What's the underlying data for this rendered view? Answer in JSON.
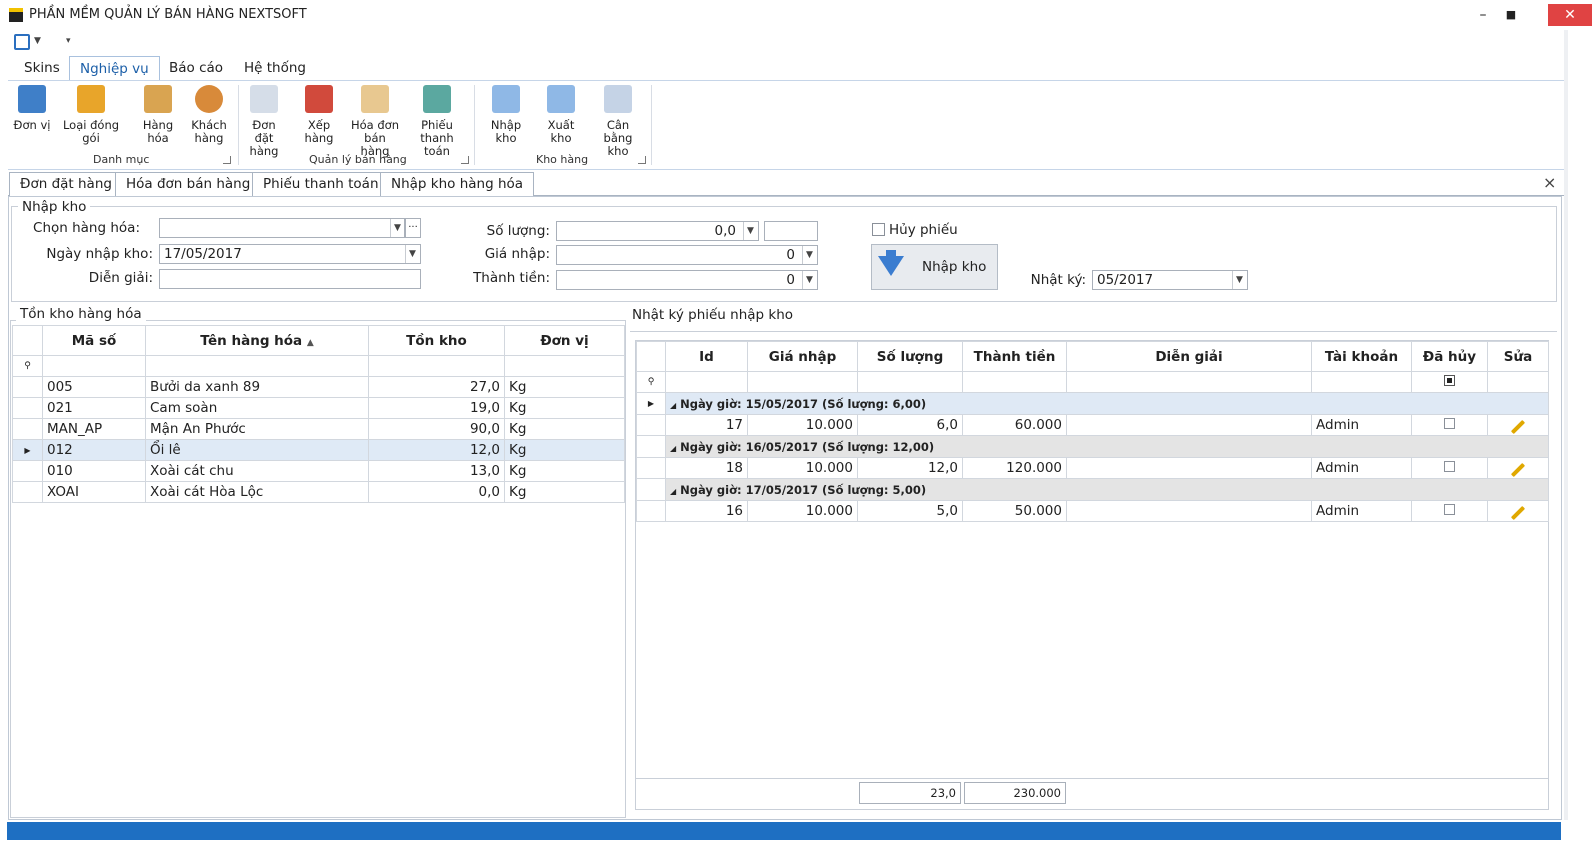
{
  "window": {
    "title": "PHẦN MỀM QUẢN LÝ BÁN HÀNG NEXTSOFT",
    "minimize": "–",
    "maximize": "■",
    "close": "✕"
  },
  "ribbon_tabs": [
    "Skins",
    "Nghiệp vụ",
    "Báo cáo",
    "Hệ thống"
  ],
  "ribbon": {
    "groups": [
      {
        "label": "Danh mục",
        "buttons": [
          "Đơn vị",
          "Loại đóng gói",
          "Hàng hóa",
          "Khách hàng"
        ]
      },
      {
        "label": "Quản lý bán hàng",
        "buttons": [
          "Đơn đặt hàng",
          "Xếp hàng",
          "Hóa đơn bán hàng",
          "Phiếu thanh toán"
        ]
      },
      {
        "label": "Kho hàng",
        "buttons": [
          "Nhập kho",
          "Xuất kho",
          "Cân bằng kho"
        ]
      }
    ]
  },
  "doc_tabs": [
    "Đơn đặt hàng",
    "Hóa đơn bán hàng",
    "Phiếu thanh toán",
    "Nhập kho hàng hóa"
  ],
  "doc_close": "×",
  "nhap_kho": {
    "title": "Nhập kho",
    "chon_hang_label": "Chọn hàng hóa:",
    "ngay_label": "Ngày nhập kho:",
    "ngay_value": "17/05/2017",
    "dien_giai_label": "Diễn giải:",
    "so_luong_label": "Số lượng:",
    "so_luong_value": "0,0",
    "gia_nhap_label": "Giá nhập:",
    "gia_nhap_value": "0",
    "thanh_tien_label": "Thành tiền:",
    "thanh_tien_value": "0",
    "huy_phieu_label": "Hủy phiếu",
    "button_label": "Nhập kho",
    "nhat_ky_label": "Nhật ký:",
    "nhat_ky_value": "05/2017"
  },
  "ton_kho": {
    "title": "Tồn kho hàng hóa",
    "columns": [
      "Mã số",
      "Tên hàng hóa",
      "Tồn kho",
      "Đơn vị"
    ],
    "rows": [
      [
        "005",
        "Bưởi da xanh 89",
        "27,0",
        "Kg"
      ],
      [
        "021",
        "Cam soàn",
        "19,0",
        "Kg"
      ],
      [
        "MAN_AP",
        "Mận An Phước",
        "90,0",
        "Kg"
      ],
      [
        "012",
        "Ổi lê",
        "12,0",
        "Kg"
      ],
      [
        "010",
        "Xoài cát chu",
        "13,0",
        "Kg"
      ],
      [
        "XOAI",
        "Xoài cát Hòa Lộc",
        "0,0",
        "Kg"
      ]
    ]
  },
  "nhat_ky": {
    "title": "Nhật ký phiếu nhập kho",
    "columns": [
      "Id",
      "Giá nhập",
      "Số lượng",
      "Thành tiền",
      "Diễn giải",
      "Tài khoản",
      "Đã hủy",
      "Sửa"
    ],
    "groups": [
      {
        "header": "Ngày giờ: 15/05/2017 (Số lượng: 6,00)",
        "row": [
          "17",
          "10.000",
          "6,0",
          "60.000",
          "",
          "Admin"
        ]
      },
      {
        "header": "Ngày giờ: 16/05/2017 (Số lượng: 12,00)",
        "row": [
          "18",
          "10.000",
          "12,0",
          "120.000",
          "",
          "Admin"
        ]
      },
      {
        "header": "Ngày giờ: 17/05/2017 (Số lượng: 5,00)",
        "row": [
          "16",
          "10.000",
          "5,0",
          "50.000",
          "",
          "Admin"
        ]
      }
    ],
    "total_so_luong": "23,0",
    "total_thanh_tien": "230.000"
  },
  "colors": {
    "accent": "#1e6fc2",
    "group_header": "#dfe9f5",
    "selected_row": "#dfeaf6"
  }
}
